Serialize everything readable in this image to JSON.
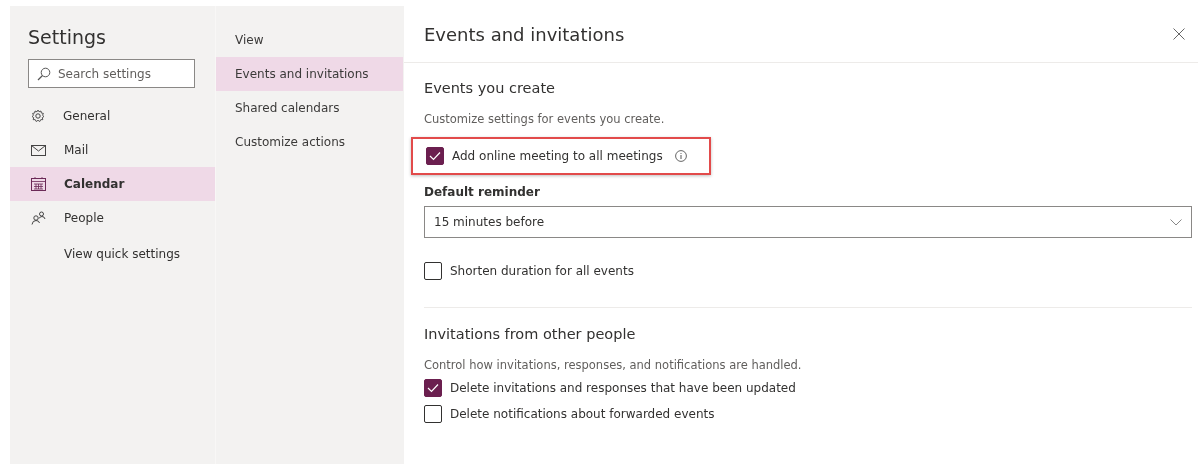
{
  "settings": {
    "title": "Settings",
    "search": {
      "placeholder": "Search settings"
    },
    "nav": [
      {
        "kind": "gear",
        "label": "General",
        "selected": false
      },
      {
        "kind": "mail",
        "label": "Mail",
        "selected": false
      },
      {
        "kind": "calendar",
        "label": "Calendar",
        "selected": true
      },
      {
        "kind": "people",
        "label": "People",
        "selected": false
      },
      {
        "kind": "link",
        "label": "View quick settings",
        "selected": false
      }
    ]
  },
  "subnav": [
    {
      "label": "View",
      "selected": false
    },
    {
      "label": "Events and invitations",
      "selected": true
    },
    {
      "label": "Shared calendars",
      "selected": false
    },
    {
      "label": "Customize actions",
      "selected": false
    }
  ],
  "panel": {
    "title": "Events and invitations",
    "sections": [
      {
        "heading": "Events you create",
        "description": "Customize settings for events you create.",
        "items": [
          {
            "kind": "checkbox",
            "label": "Add online meeting to all meetings",
            "checked": true,
            "info": true,
            "highlighted": true
          },
          {
            "kind": "select",
            "label": "Default reminder",
            "value": "15 minutes before"
          },
          {
            "kind": "checkbox",
            "label": "Shorten duration for all events",
            "checked": false,
            "info": false,
            "highlighted": false
          }
        ]
      },
      {
        "heading": "Invitations from other people",
        "description": "Control how invitations, responses, and notifications are handled.",
        "items": [
          {
            "kind": "checkbox",
            "label": "Delete invitations and responses that have been updated",
            "checked": true,
            "info": false,
            "highlighted": false
          },
          {
            "kind": "checkbox",
            "label": "Delete notifications about forwarded events",
            "checked": false,
            "info": false,
            "highlighted": false
          }
        ]
      }
    ]
  }
}
